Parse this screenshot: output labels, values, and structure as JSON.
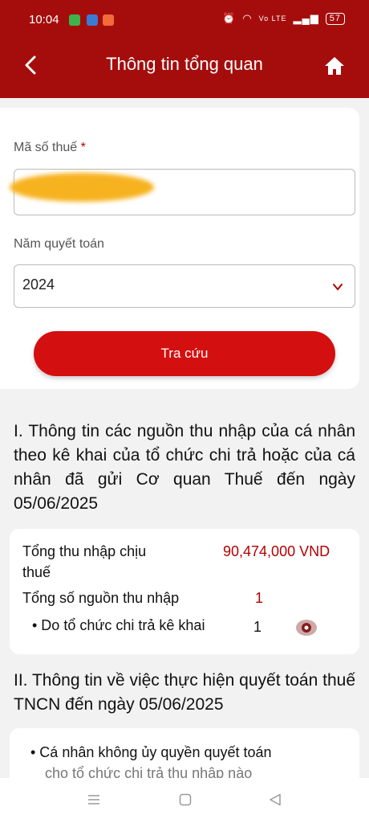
{
  "status": {
    "time": "10:04",
    "right_text": "Vo LTE",
    "battery": "57"
  },
  "header": {
    "title": "Thông tin tổng quan"
  },
  "form": {
    "tax_code_label": "Mã số thuế",
    "required_mark": "*",
    "tax_code_value": "",
    "year_label": "Năm quyết toán",
    "year_value": "2024",
    "search_button": "Tra cứu"
  },
  "section1": {
    "heading": "I. Thông tin các nguồn thu nhập của cá nhân theo kê khai của tổ chức chi trả hoặc của cá nhân đã gửi Cơ quan Thuế đến ngày 05/06/2025",
    "total_income_label_1": "Tổng thu nhập chịu",
    "total_income_label_2": "thuế",
    "total_income_value": "90,474,000 VND",
    "sources_label": "Tổng số nguồn thu nhập",
    "sources_value": "1",
    "org_label": "• Do tổ chức chi trả kê khai",
    "org_value": "1"
  },
  "section2": {
    "heading": "II. Thông tin về việc thực hiện quyết toán thuế TNCN đến ngày 05/06/2025",
    "item_1": "• Cá nhân không ủy quyền quyết toán",
    "item_2": "cho tổ chức chi trả thu nhập nào"
  },
  "colors": {
    "header": "#a50d0d",
    "button": "#d40f0f",
    "value_red": "#b30000"
  }
}
